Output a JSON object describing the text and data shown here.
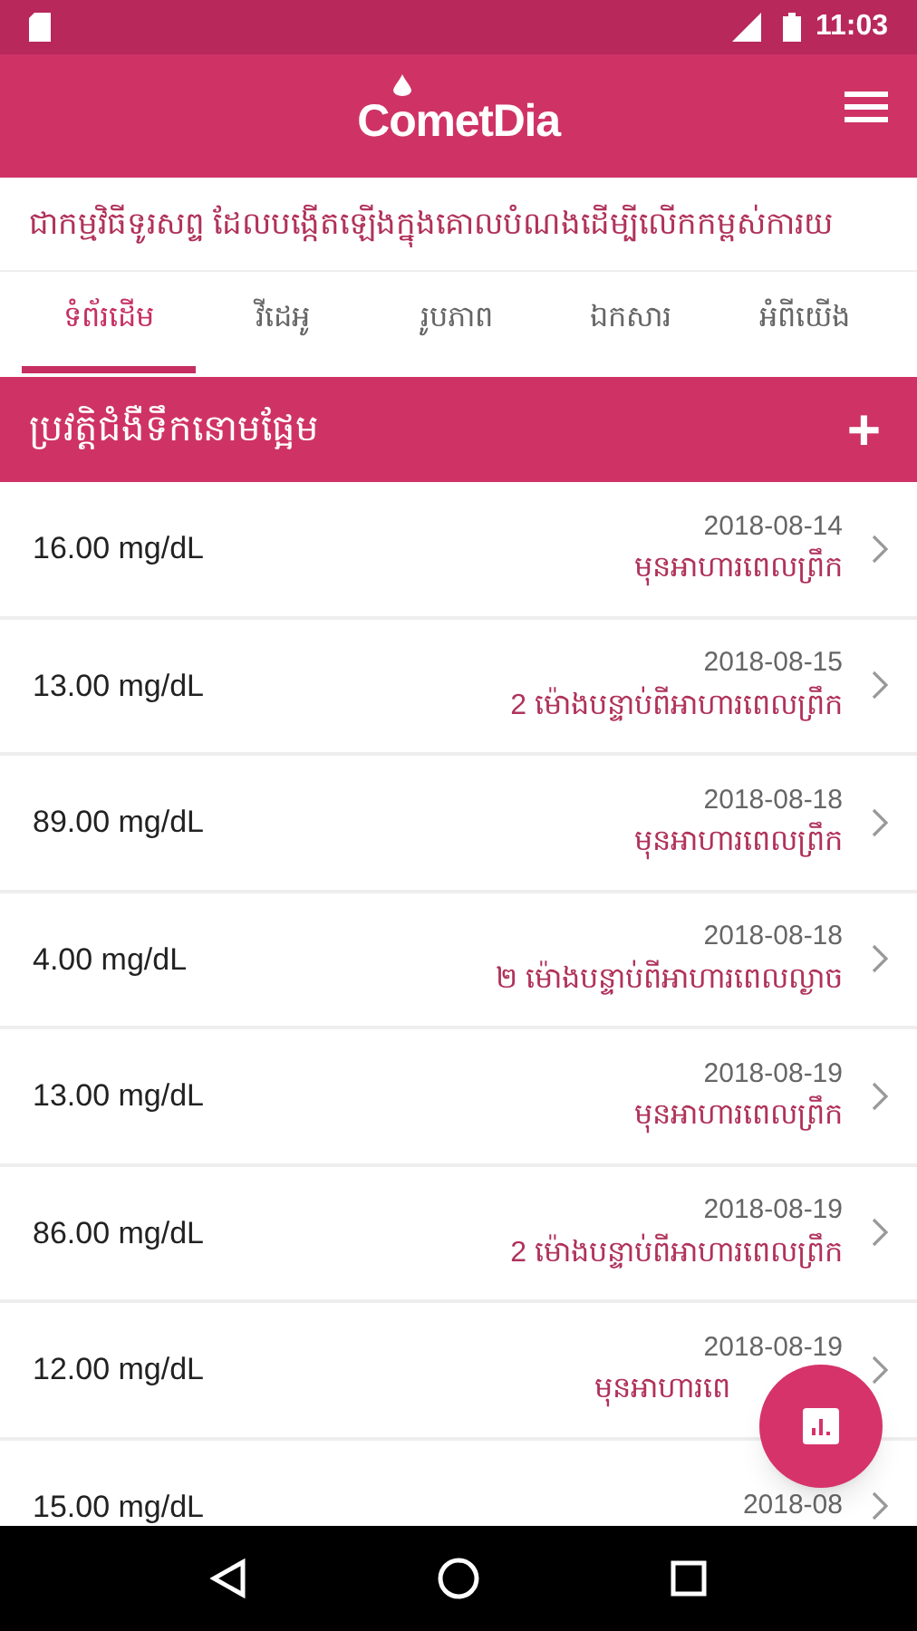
{
  "status_bar": {
    "time": "11:03"
  },
  "app_bar": {
    "logo": "CometDia"
  },
  "marquee": "ជាកម្មវិធីទូរសព្ទ ដែលបង្កើតឡើងក្នុងគោលបំណងដើម្បីលើកកម្ពស់ការយ",
  "tabs": [
    {
      "label": "ទំព័រដើម",
      "selected": true
    },
    {
      "label": "វីដេអូ",
      "selected": false
    },
    {
      "label": "រូបភាព",
      "selected": false
    },
    {
      "label": "ឯកសារ",
      "selected": false
    },
    {
      "label": "អំពីយើង",
      "selected": false
    }
  ],
  "section": {
    "title": "ប្រវត្តិជំងឺទឹកនោមផ្អែម",
    "add_label": "+"
  },
  "rows": [
    {
      "value": "16.00 mg/dL",
      "date": "2018-08-14",
      "meal": "មុនអាហារពេលព្រឹក"
    },
    {
      "value": "13.00 mg/dL",
      "date": "2018-08-15",
      "meal": "2 ម៉ោងបន្ទាប់ពីអាហារពេលព្រឹក"
    },
    {
      "value": "89.00 mg/dL",
      "date": "2018-08-18",
      "meal": "មុនអាហារពេលព្រឹក"
    },
    {
      "value": "4.00 mg/dL",
      "date": "2018-08-18",
      "meal": "២ ម៉ោងបន្ទាប់ពីអាហារពេលល្ងាច"
    },
    {
      "value": "13.00 mg/dL",
      "date": "2018-08-19",
      "meal": "មុនអាហារពេលព្រឹក"
    },
    {
      "value": "86.00 mg/dL",
      "date": "2018-08-19",
      "meal": "2 ម៉ោងបន្ទាប់ពីអាហារពេលព្រឹក"
    },
    {
      "value": "12.00 mg/dL",
      "date": "2018-08-19",
      "meal": "មុនអាហារពេ",
      "covered": true
    },
    {
      "value": "15.00 mg/dL",
      "date": "2018-08"
    }
  ]
}
